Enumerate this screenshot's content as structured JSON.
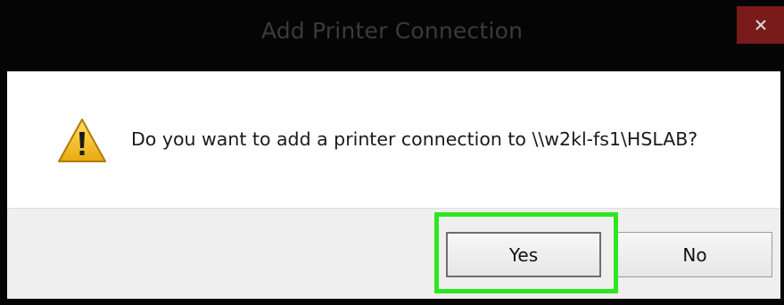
{
  "dialog": {
    "title": "Add Printer Connection",
    "close_icon": "close-icon",
    "message": "Do you want to add a printer connection to \\\\w2kl-fs1\\HSLAB?",
    "warning_icon": "warning-icon"
  },
  "buttons": {
    "yes_label": "Yes",
    "no_label": "No",
    "highlighted": "Yes"
  },
  "colors": {
    "titlebar": "#050505",
    "close_button": "#7a1b1b",
    "footer": "#efefef",
    "highlight": "#2ee620",
    "warning_fill": "#f2c21a"
  }
}
